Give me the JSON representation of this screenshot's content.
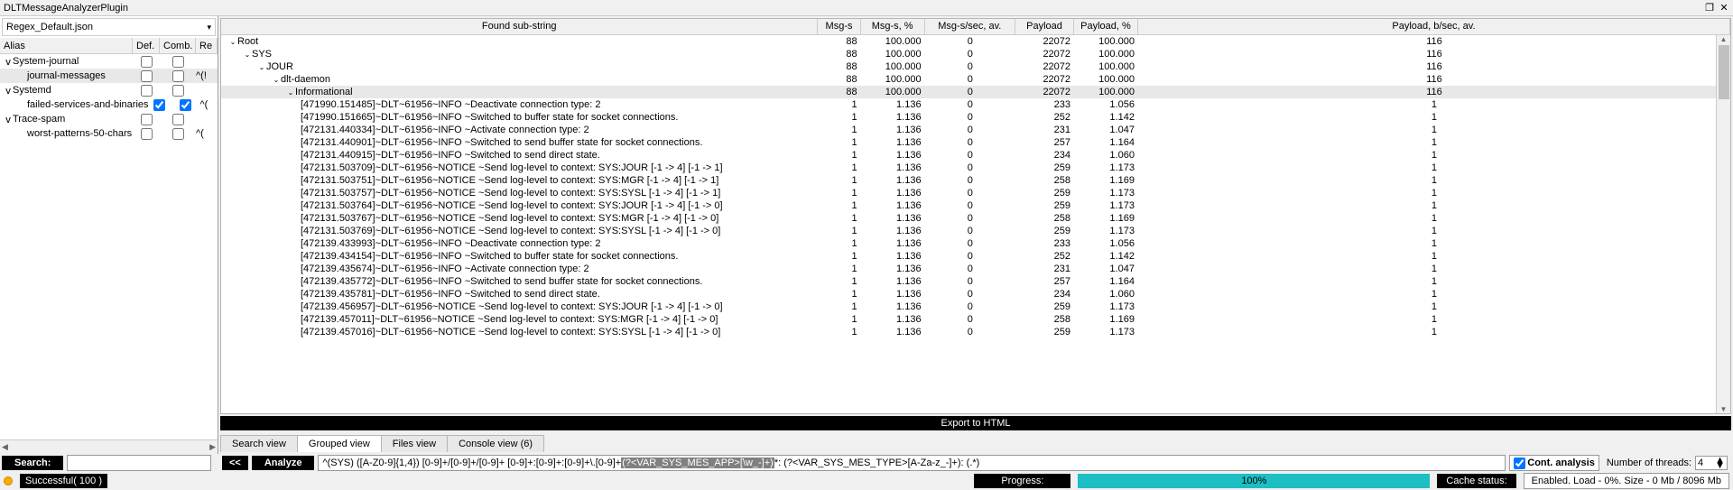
{
  "title": "DLTMessageAnalyzerPlugin",
  "win_btns": {
    "restore": "❐",
    "close": "✕"
  },
  "combo": "Regex_Default.json",
  "alias_hdr": {
    "c0": "Alias",
    "c1": "Def.",
    "c2": "Comb.",
    "c3": "Re"
  },
  "tree": [
    {
      "indent": 0,
      "tg": "v",
      "label": "System-journal",
      "def": false,
      "comb": false,
      "re": ""
    },
    {
      "indent": 1,
      "tg": "",
      "label": "journal-messages",
      "def": false,
      "comb": false,
      "re": "^(!",
      "sel": true
    },
    {
      "indent": 0,
      "tg": "v",
      "label": "Systemd",
      "def": false,
      "comb": false,
      "re": ""
    },
    {
      "indent": 1,
      "tg": "",
      "label": "failed-services-and-binaries",
      "def": true,
      "comb": true,
      "re": "^("
    },
    {
      "indent": 0,
      "tg": "v",
      "label": "Trace-spam",
      "def": false,
      "comb": false,
      "re": ""
    },
    {
      "indent": 1,
      "tg": "",
      "label": "worst-patterns-50-chars",
      "def": false,
      "comb": false,
      "re": "^("
    }
  ],
  "grid_hdr": {
    "sub": "Found sub-string",
    "msg": "Msg-s",
    "pctm": "Msg-s, %",
    "mps": "Msg-s/sec, av.",
    "pl": "Payload",
    "plp": "Payload, %",
    "plb": "Payload, b/sec, av."
  },
  "rows": [
    {
      "sub": "Root",
      "ind": 0,
      "tg": "v",
      "m": "88",
      "mp": "100.000",
      "ms": "0",
      "pl": "22072",
      "pp": "100.000",
      "pb": "116"
    },
    {
      "sub": "SYS",
      "ind": 1,
      "tg": "v",
      "m": "88",
      "mp": "100.000",
      "ms": "0",
      "pl": "22072",
      "pp": "100.000",
      "pb": "116"
    },
    {
      "sub": "JOUR",
      "ind": 2,
      "tg": "v",
      "m": "88",
      "mp": "100.000",
      "ms": "0",
      "pl": "22072",
      "pp": "100.000",
      "pb": "116"
    },
    {
      "sub": "dlt-daemon",
      "ind": 3,
      "tg": "v",
      "m": "88",
      "mp": "100.000",
      "ms": "0",
      "pl": "22072",
      "pp": "100.000",
      "pb": "116"
    },
    {
      "sub": "Informational",
      "ind": 4,
      "tg": "v",
      "m": "88",
      "mp": "100.000",
      "ms": "0",
      "pl": "22072",
      "pp": "100.000",
      "pb": "116",
      "sel": true
    },
    {
      "sub": "[471990.151485]~DLT~61956~INFO    ~Deactivate connection type: 2",
      "ind": 5,
      "m": "1",
      "mp": "1.136",
      "ms": "0",
      "pl": "233",
      "pp": "1.056",
      "pb": "1"
    },
    {
      "sub": "[471990.151665]~DLT~61956~INFO    ~Switched to buffer state for socket connections.",
      "ind": 5,
      "m": "1",
      "mp": "1.136",
      "ms": "0",
      "pl": "252",
      "pp": "1.142",
      "pb": "1"
    },
    {
      "sub": "[472131.440334]~DLT~61956~INFO    ~Activate connection type: 2",
      "ind": 5,
      "m": "1",
      "mp": "1.136",
      "ms": "0",
      "pl": "231",
      "pp": "1.047",
      "pb": "1"
    },
    {
      "sub": "[472131.440901]~DLT~61956~INFO    ~Switched to send buffer state for socket connections.",
      "ind": 5,
      "m": "1",
      "mp": "1.136",
      "ms": "0",
      "pl": "257",
      "pp": "1.164",
      "pb": "1"
    },
    {
      "sub": "[472131.440915]~DLT~61956~INFO    ~Switched to send direct state.",
      "ind": 5,
      "m": "1",
      "mp": "1.136",
      "ms": "0",
      "pl": "234",
      "pp": "1.060",
      "pb": "1"
    },
    {
      "sub": "[472131.503709]~DLT~61956~NOTICE   ~Send log-level to context: SYS:JOUR [-1 -> 4] [-1 -> 1]",
      "ind": 5,
      "m": "1",
      "mp": "1.136",
      "ms": "0",
      "pl": "259",
      "pp": "1.173",
      "pb": "1"
    },
    {
      "sub": "[472131.503751]~DLT~61956~NOTICE   ~Send log-level to context: SYS:MGR [-1 -> 4] [-1 -> 1]",
      "ind": 5,
      "m": "1",
      "mp": "1.136",
      "ms": "0",
      "pl": "258",
      "pp": "1.169",
      "pb": "1"
    },
    {
      "sub": "[472131.503757]~DLT~61956~NOTICE   ~Send log-level to context: SYS:SYSL [-1 -> 4] [-1 -> 1]",
      "ind": 5,
      "m": "1",
      "mp": "1.136",
      "ms": "0",
      "pl": "259",
      "pp": "1.173",
      "pb": "1"
    },
    {
      "sub": "[472131.503764]~DLT~61956~NOTICE   ~Send log-level to context: SYS:JOUR [-1 -> 4] [-1 -> 0]",
      "ind": 5,
      "m": "1",
      "mp": "1.136",
      "ms": "0",
      "pl": "259",
      "pp": "1.173",
      "pb": "1"
    },
    {
      "sub": "[472131.503767]~DLT~61956~NOTICE   ~Send log-level to context: SYS:MGR [-1 -> 4] [-1 -> 0]",
      "ind": 5,
      "m": "1",
      "mp": "1.136",
      "ms": "0",
      "pl": "258",
      "pp": "1.169",
      "pb": "1"
    },
    {
      "sub": "[472131.503769]~DLT~61956~NOTICE   ~Send log-level to context: SYS:SYSL [-1 -> 4] [-1 -> 0]",
      "ind": 5,
      "m": "1",
      "mp": "1.136",
      "ms": "0",
      "pl": "259",
      "pp": "1.173",
      "pb": "1"
    },
    {
      "sub": "[472139.433993]~DLT~61956~INFO    ~Deactivate connection type: 2",
      "ind": 5,
      "m": "1",
      "mp": "1.136",
      "ms": "0",
      "pl": "233",
      "pp": "1.056",
      "pb": "1"
    },
    {
      "sub": "[472139.434154]~DLT~61956~INFO    ~Switched to buffer state for socket connections.",
      "ind": 5,
      "m": "1",
      "mp": "1.136",
      "ms": "0",
      "pl": "252",
      "pp": "1.142",
      "pb": "1"
    },
    {
      "sub": "[472139.435674]~DLT~61956~INFO    ~Activate connection type: 2",
      "ind": 5,
      "m": "1",
      "mp": "1.136",
      "ms": "0",
      "pl": "231",
      "pp": "1.047",
      "pb": "1"
    },
    {
      "sub": "[472139.435772]~DLT~61956~INFO    ~Switched to send buffer state for socket connections.",
      "ind": 5,
      "m": "1",
      "mp": "1.136",
      "ms": "0",
      "pl": "257",
      "pp": "1.164",
      "pb": "1"
    },
    {
      "sub": "[472139.435781]~DLT~61956~INFO    ~Switched to send direct state.",
      "ind": 5,
      "m": "1",
      "mp": "1.136",
      "ms": "0",
      "pl": "234",
      "pp": "1.060",
      "pb": "1"
    },
    {
      "sub": "[472139.456957]~DLT~61956~NOTICE   ~Send log-level to context: SYS:JOUR [-1 -> 4] [-1 -> 0]",
      "ind": 5,
      "m": "1",
      "mp": "1.136",
      "ms": "0",
      "pl": "259",
      "pp": "1.173",
      "pb": "1"
    },
    {
      "sub": "[472139.457011]~DLT~61956~NOTICE   ~Send log-level to context: SYS:MGR [-1 -> 4] [-1 -> 0]",
      "ind": 5,
      "m": "1",
      "mp": "1.136",
      "ms": "0",
      "pl": "258",
      "pp": "1.169",
      "pb": "1"
    },
    {
      "sub": "[472139.457016]~DLT~61956~NOTICE   ~Send log-level to context: SYS:SYSL [-1 -> 4] [-1 -> 0]",
      "ind": 5,
      "m": "1",
      "mp": "1.136",
      "ms": "0",
      "pl": "259",
      "pp": "1.173",
      "pb": "1"
    }
  ],
  "export": "Export to HTML",
  "tabs": [
    {
      "l": "Search view"
    },
    {
      "l": "Grouped view",
      "a": true
    },
    {
      "l": "Files view"
    },
    {
      "l": "Console view (6)"
    }
  ],
  "search_lbl": "Search:",
  "back_btn": "<<",
  "analyze_btn": "Analyze",
  "regex": {
    "pre": "^(SYS) ([A-Z0-9]{1,4}) [0-9]+/[0-9]+/[0-9]+ [0-9]+:[0-9]+:[0-9]+\\.[0-9]+ ",
    "hl": "(?<VAR_SYS_MES_APP>[\\w_-]+)",
    "post": "*: (?<VAR_SYS_MES_TYPE>[A-Za-z_-]+): (.*)"
  },
  "cont_lbl": "Cont. analysis",
  "nthr_lbl": "Number of threads:",
  "nthr_v": "4",
  "status": {
    "succ": "Successful( 100 )",
    "prog_l": "Progress:",
    "prog_v": "100%",
    "cache_l": "Cache status:",
    "cache_v": "Enabled. Load - 0%. Size - 0 Mb / 8096 Mb"
  }
}
